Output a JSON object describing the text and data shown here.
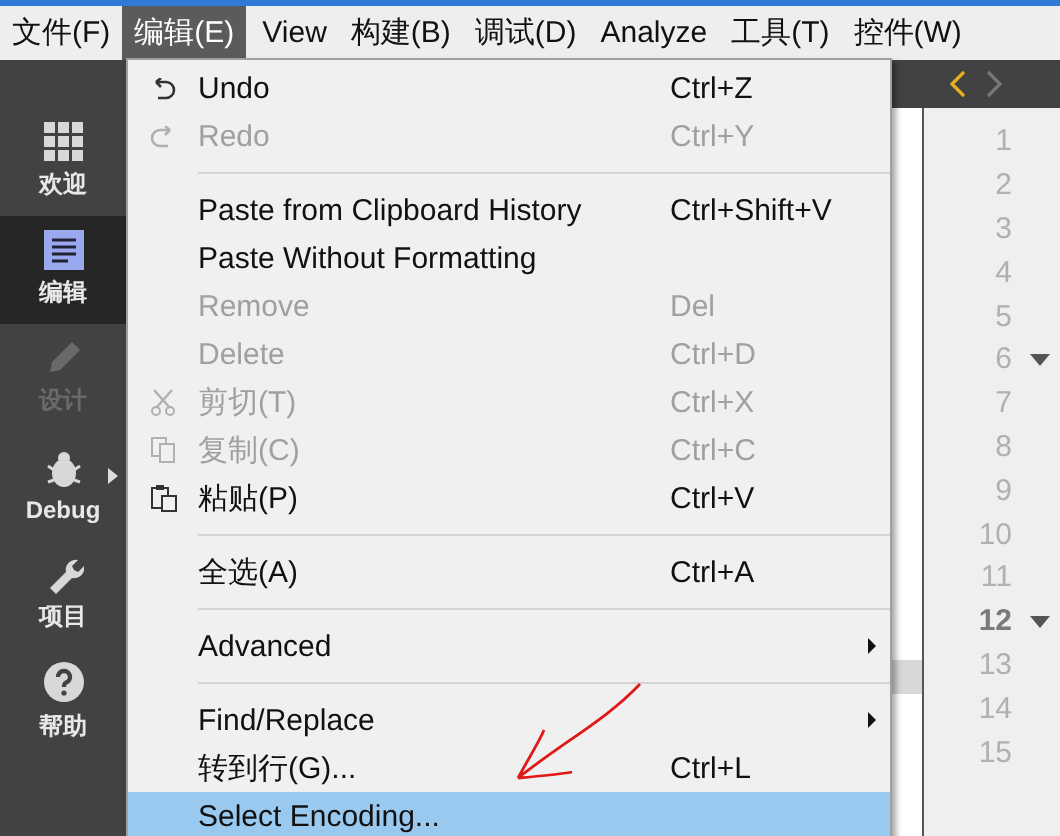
{
  "menu_bar": [
    {
      "label": "文件(F)",
      "selected": false
    },
    {
      "label": "编辑(E)",
      "selected": true
    },
    {
      "label": "View",
      "selected": false
    },
    {
      "label": "构建(B)",
      "selected": false
    },
    {
      "label": "调试(D)",
      "selected": false
    },
    {
      "label": "Analyze",
      "selected": false
    },
    {
      "label": "工具(T)",
      "selected": false
    },
    {
      "label": "控件(W)",
      "selected": false
    }
  ],
  "sidebar": [
    {
      "label": "欢迎",
      "selected": false,
      "disabled": false
    },
    {
      "label": "编辑",
      "selected": true,
      "disabled": false
    },
    {
      "label": "设计",
      "selected": false,
      "disabled": true
    },
    {
      "label": "Debug",
      "selected": false,
      "disabled": false
    },
    {
      "label": "项目",
      "selected": false,
      "disabled": false
    },
    {
      "label": "帮助",
      "selected": false,
      "disabled": false
    }
  ],
  "edit_menu": [
    {
      "kind": "item",
      "label": "Undo",
      "shortcut": "Ctrl+Z",
      "disabled": false,
      "selected": false
    },
    {
      "kind": "item",
      "label": "Redo",
      "shortcut": "Ctrl+Y",
      "disabled": true,
      "selected": false
    },
    {
      "kind": "separator"
    },
    {
      "kind": "item",
      "label": "Paste from Clipboard History",
      "shortcut": "Ctrl+Shift+V",
      "disabled": false,
      "selected": false
    },
    {
      "kind": "item",
      "label": "Paste Without Formatting",
      "disabled": false,
      "selected": false
    },
    {
      "kind": "item",
      "label": "Remove",
      "shortcut": "Del",
      "disabled": true,
      "selected": false
    },
    {
      "kind": "item",
      "label": "Delete",
      "shortcut": "Ctrl+D",
      "disabled": true,
      "selected": false
    },
    {
      "kind": "item",
      "label": "剪切(T)",
      "shortcut": "Ctrl+X",
      "disabled": true,
      "selected": false
    },
    {
      "kind": "item",
      "label": "复制(C)",
      "shortcut": "Ctrl+C",
      "disabled": true,
      "selected": false
    },
    {
      "kind": "item",
      "label": "粘贴(P)",
      "shortcut": "Ctrl+V",
      "disabled": false,
      "selected": false
    },
    {
      "kind": "separator"
    },
    {
      "kind": "item",
      "label": "全选(A)",
      "shortcut": "Ctrl+A",
      "disabled": false,
      "selected": false
    },
    {
      "kind": "separator"
    },
    {
      "kind": "submenu",
      "label": "Advanced",
      "disabled": false,
      "selected": false
    },
    {
      "kind": "separator"
    },
    {
      "kind": "submenu",
      "label": "Find/Replace",
      "disabled": false,
      "selected": false
    },
    {
      "kind": "item",
      "label": "转到行(G)...",
      "shortcut": "Ctrl+L",
      "disabled": false,
      "selected": false
    },
    {
      "kind": "item",
      "label": "Select Encoding...",
      "disabled": false,
      "selected": true
    }
  ],
  "editor": {
    "line_numbers": [
      {
        "label": "1",
        "current": false,
        "fold": false
      },
      {
        "label": "2",
        "current": false,
        "fold": false
      },
      {
        "label": "3",
        "current": false,
        "fold": false
      },
      {
        "label": "4",
        "current": false,
        "fold": false
      },
      {
        "label": "5",
        "current": false,
        "fold": false
      },
      {
        "label": "6",
        "current": false,
        "fold": true
      },
      {
        "label": "7",
        "current": false,
        "fold": false
      },
      {
        "label": "8",
        "current": false,
        "fold": false
      },
      {
        "label": "9",
        "current": false,
        "fold": false
      },
      {
        "label": "10",
        "current": false,
        "fold": false
      },
      {
        "label": "11",
        "current": false,
        "fold": false
      },
      {
        "label": "12",
        "current": true,
        "fold": true
      },
      {
        "label": "13",
        "current": false,
        "fold": false
      },
      {
        "label": "14",
        "current": false,
        "fold": false
      },
      {
        "label": "15",
        "current": false,
        "fold": false
      }
    ]
  }
}
